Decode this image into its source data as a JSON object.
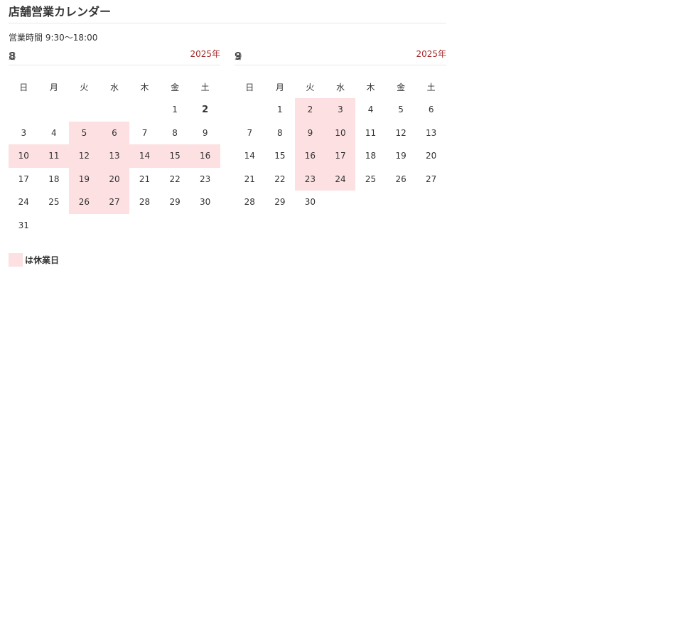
{
  "page": {
    "title": "店舗営業カレンダー",
    "hours": "営業時間 9:30〜18:00"
  },
  "weekdays": [
    "日",
    "月",
    "火",
    "水",
    "木",
    "金",
    "土"
  ],
  "months": [
    {
      "month": "8",
      "unit": "月",
      "year": "2025年",
      "weeks": [
        [
          null,
          null,
          null,
          null,
          null,
          1,
          2
        ],
        [
          3,
          4,
          5,
          6,
          7,
          8,
          9
        ],
        [
          10,
          11,
          12,
          13,
          14,
          15,
          16
        ],
        [
          17,
          18,
          19,
          20,
          21,
          22,
          23
        ],
        [
          24,
          25,
          26,
          27,
          28,
          29,
          30
        ],
        [
          31,
          null,
          null,
          null,
          null,
          null,
          null
        ]
      ],
      "closed": [
        5,
        6,
        10,
        11,
        12,
        13,
        14,
        15,
        16,
        19,
        20,
        26,
        27
      ],
      "today": 2
    },
    {
      "month": "9",
      "unit": "月",
      "year": "2025年",
      "weeks": [
        [
          null,
          1,
          2,
          3,
          4,
          5,
          6
        ],
        [
          7,
          8,
          9,
          10,
          11,
          12,
          13
        ],
        [
          14,
          15,
          16,
          17,
          18,
          19,
          20
        ],
        [
          21,
          22,
          23,
          24,
          25,
          26,
          27
        ],
        [
          28,
          29,
          30,
          null,
          null,
          null,
          null
        ]
      ],
      "closed": [
        2,
        3,
        9,
        10,
        16,
        17,
        23,
        24
      ],
      "today": null
    }
  ],
  "legend": {
    "text": "は休業日",
    "swatch_color": "#fde0e2"
  },
  "colors": {
    "closed_bg": "#fde0e2",
    "year_text": "#a52a2a",
    "divider": "#e8e8e8"
  }
}
